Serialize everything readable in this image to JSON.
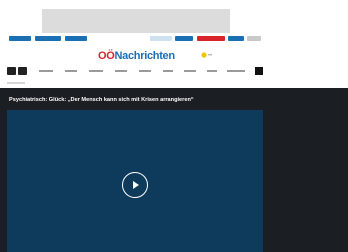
{
  "logo": {
    "prefix": "OÖ",
    "name": "Nachrichten"
  },
  "article": {
    "headline": "Psychiatrisch: Glück: „Der Mensch kann sich mit Krisen arrangieren“"
  },
  "icons": {
    "play": "play-icon",
    "weather": "sun-icon"
  },
  "colors": {
    "brand_blue": "#1a6fb5",
    "brand_red": "#d8232a",
    "video_bg": "#0e3a5c",
    "page_bg": "#1b1f24"
  }
}
